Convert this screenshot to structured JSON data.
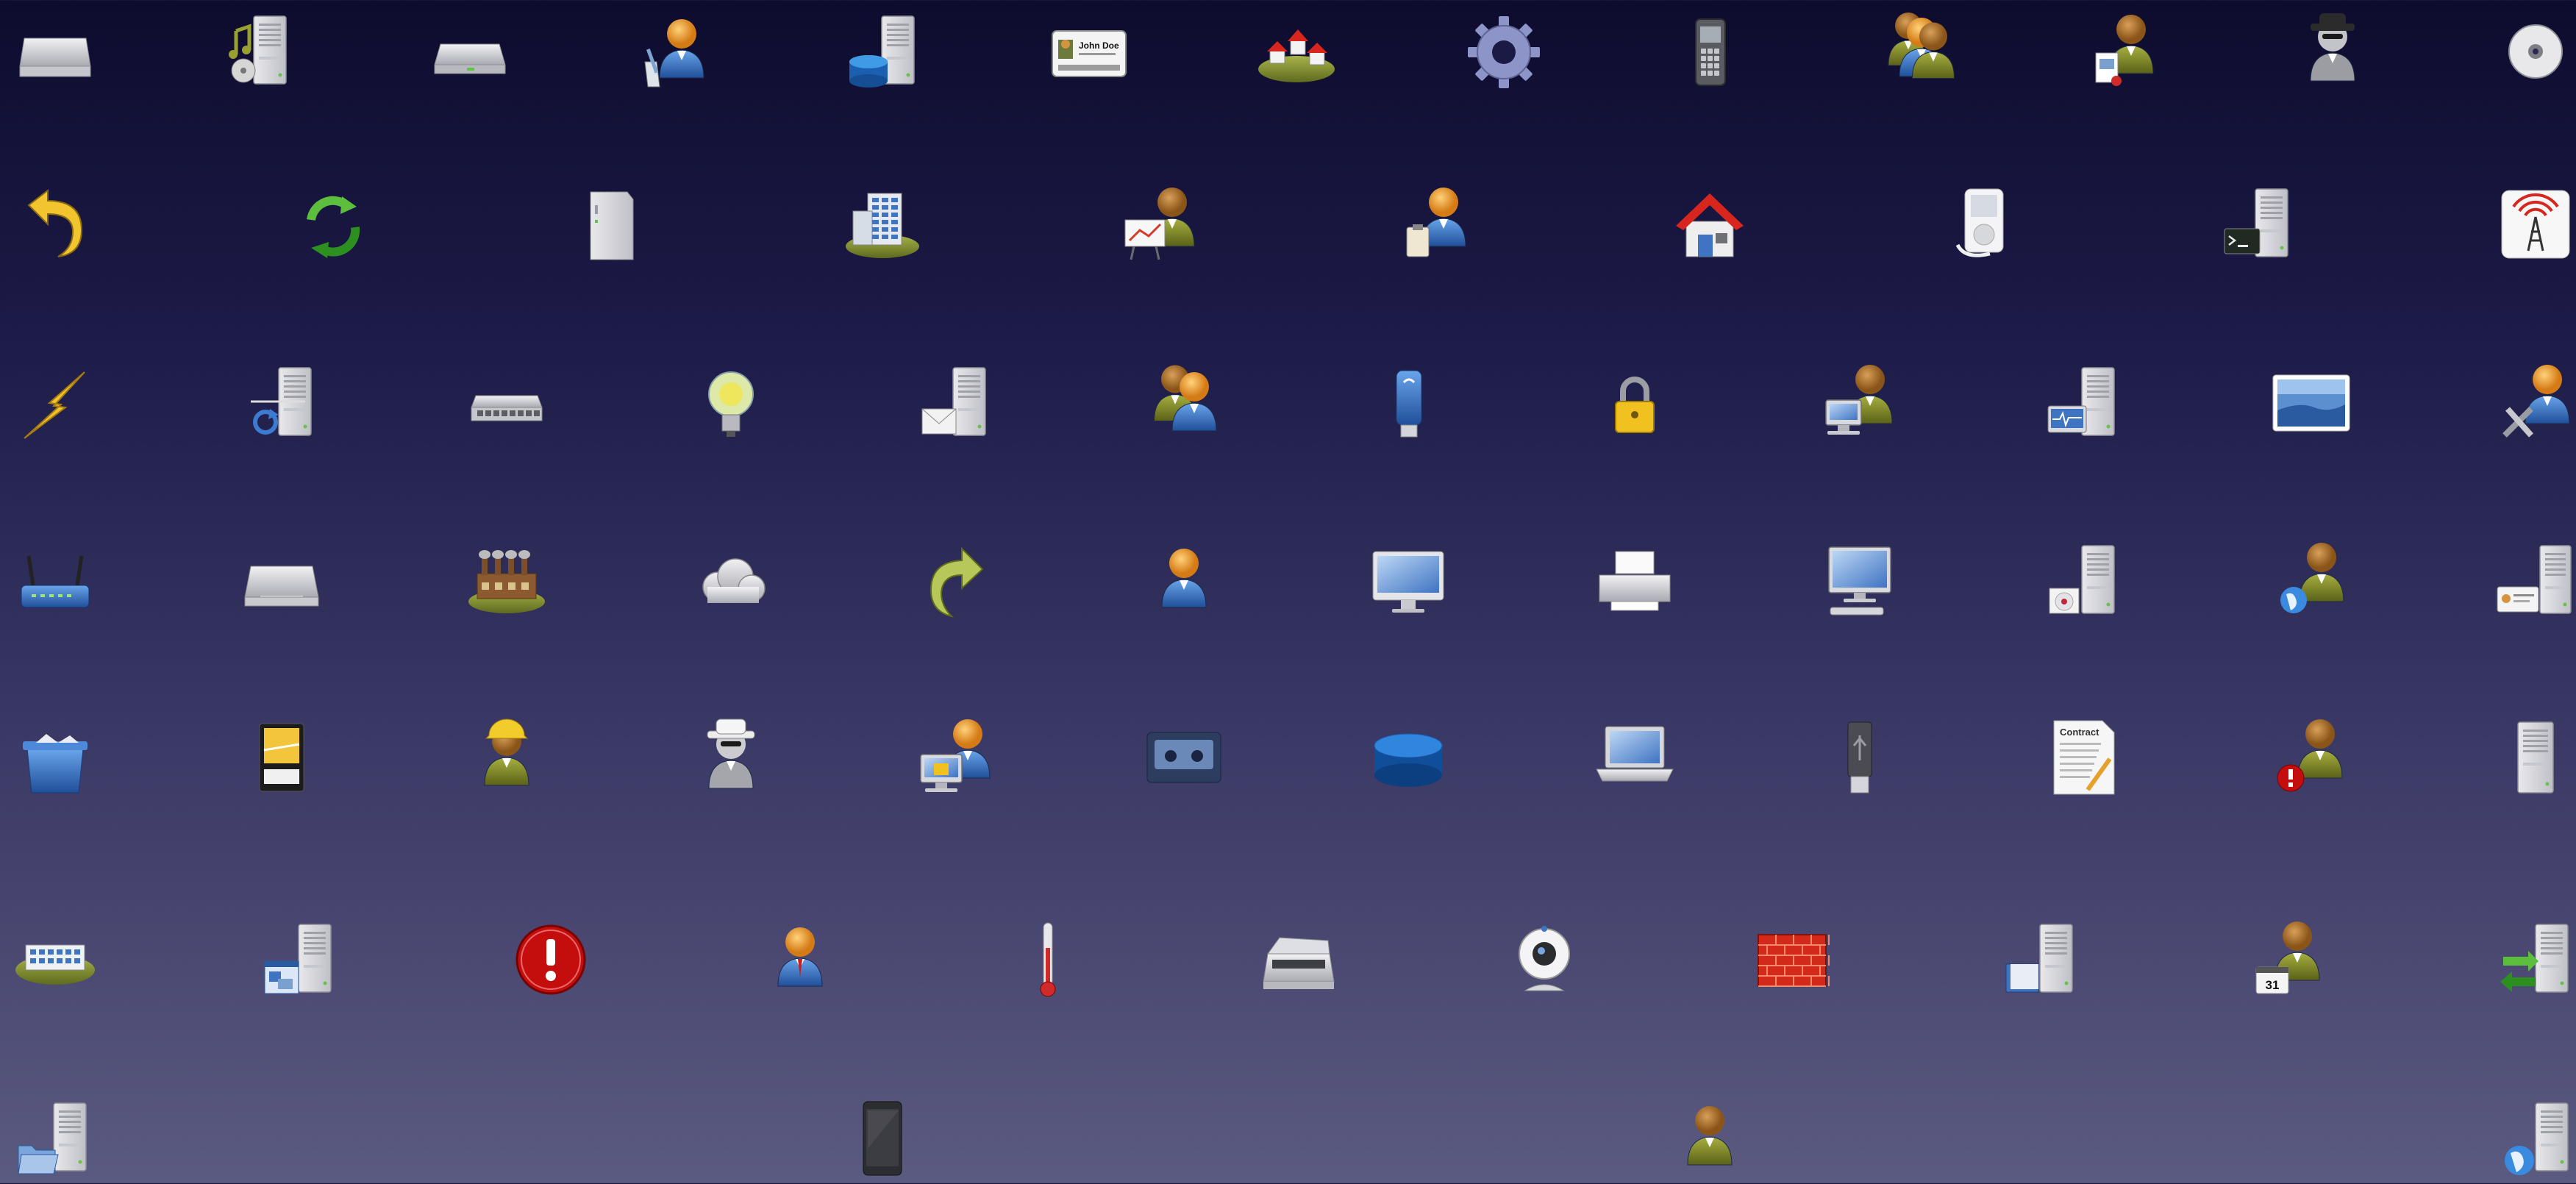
{
  "canvas": {
    "background_top": "#0d0c2e",
    "background_bottom": "#5b5a80"
  },
  "icons": [
    {
      "name": "harddisk-icon",
      "row": 0,
      "col": 0
    },
    {
      "name": "media-server-icon",
      "row": 0,
      "col": 1
    },
    {
      "name": "nas-drive-icon",
      "row": 0,
      "col": 2
    },
    {
      "name": "user-edit-icon",
      "row": 0,
      "col": 3
    },
    {
      "name": "database-server-icon",
      "row": 0,
      "col": 4
    },
    {
      "name": "id-card-icon",
      "row": 0,
      "col": 5,
      "text": "John Doe"
    },
    {
      "name": "village-icon",
      "row": 0,
      "col": 6
    },
    {
      "name": "gear-icon",
      "row": 0,
      "col": 7
    },
    {
      "name": "mobile-phone-icon",
      "row": 0,
      "col": 8
    },
    {
      "name": "user-group-icon",
      "row": 0,
      "col": 9
    },
    {
      "name": "user-report-icon",
      "row": 0,
      "col": 10
    },
    {
      "name": "spy-icon",
      "row": 0,
      "col": 11
    },
    {
      "name": "optical-disc-icon",
      "row": 0,
      "col": 12
    },
    {
      "name": "undo-arrow-icon",
      "row": 1,
      "col": 0
    },
    {
      "name": "refresh-cycle-icon",
      "row": 1,
      "col": 1
    },
    {
      "name": "tower-case-icon",
      "row": 1,
      "col": 2
    },
    {
      "name": "office-building-icon",
      "row": 1,
      "col": 3
    },
    {
      "name": "user-presentation-icon",
      "row": 1,
      "col": 4
    },
    {
      "name": "user-clipboard-icon",
      "row": 1,
      "col": 5
    },
    {
      "name": "home-icon",
      "row": 1,
      "col": 6
    },
    {
      "name": "media-player-icon",
      "row": 1,
      "col": 7
    },
    {
      "name": "terminal-server-icon",
      "row": 1,
      "col": 8
    },
    {
      "name": "radio-tower-icon",
      "row": 1,
      "col": 9
    },
    {
      "name": "lightning-icon",
      "row": 2,
      "col": 0
    },
    {
      "name": "server-sync-icon",
      "row": 2,
      "col": 1
    },
    {
      "name": "network-switch-icon",
      "row": 2,
      "col": 2
    },
    {
      "name": "light-bulb-icon",
      "row": 2,
      "col": 3
    },
    {
      "name": "mail-server-icon",
      "row": 2,
      "col": 4
    },
    {
      "name": "user-pair-icon",
      "row": 2,
      "col": 5
    },
    {
      "name": "usb-stick-blue-icon",
      "row": 2,
      "col": 6
    },
    {
      "name": "padlock-icon",
      "row": 2,
      "col": 7
    },
    {
      "name": "user-workstation-icon",
      "row": 2,
      "col": 8
    },
    {
      "name": "server-monitor-icon",
      "row": 2,
      "col": 9
    },
    {
      "name": "landscape-image-icon",
      "row": 2,
      "col": 10
    },
    {
      "name": "user-admin-tools-icon",
      "row": 2,
      "col": 11
    },
    {
      "name": "wireless-router-icon",
      "row": 3,
      "col": 0
    },
    {
      "name": "optical-drive-icon",
      "row": 3,
      "col": 1
    },
    {
      "name": "factory-icon",
      "row": 3,
      "col": 2
    },
    {
      "name": "cloud-icon",
      "row": 3,
      "col": 3
    },
    {
      "name": "redo-arrow-icon",
      "row": 3,
      "col": 4
    },
    {
      "name": "user-icon",
      "row": 3,
      "col": 5
    },
    {
      "name": "imac-icon",
      "row": 3,
      "col": 6
    },
    {
      "name": "printer-icon",
      "row": 3,
      "col": 7
    },
    {
      "name": "desktop-computer-icon",
      "row": 3,
      "col": 8
    },
    {
      "name": "cd-server-icon",
      "row": 3,
      "col": 9
    },
    {
      "name": "user-globe-icon",
      "row": 3,
      "col": 10
    },
    {
      "name": "id-card-server-icon",
      "row": 3,
      "col": 11
    },
    {
      "name": "trash-bin-icon",
      "row": 4,
      "col": 0
    },
    {
      "name": "memory-card-icon",
      "row": 4,
      "col": 1
    },
    {
      "name": "worker-hardhat-icon",
      "row": 4,
      "col": 2
    },
    {
      "name": "spy-agent-icon",
      "row": 4,
      "col": 3
    },
    {
      "name": "user-locked-computer-icon",
      "row": 4,
      "col": 4
    },
    {
      "name": "cassette-tape-icon",
      "row": 4,
      "col": 5
    },
    {
      "name": "database-icon",
      "row": 4,
      "col": 6
    },
    {
      "name": "laptop-icon",
      "row": 4,
      "col": 7
    },
    {
      "name": "usb-drive-icon",
      "row": 4,
      "col": 8
    },
    {
      "name": "contract-document-icon",
      "row": 4,
      "col": 9,
      "text": "Contract"
    },
    {
      "name": "user-warning-icon",
      "row": 4,
      "col": 10
    },
    {
      "name": "server-icon",
      "row": 4,
      "col": 11
    },
    {
      "name": "building-block-icon",
      "row": 5,
      "col": 0
    },
    {
      "name": "server-window-icon",
      "row": 5,
      "col": 1
    },
    {
      "name": "error-icon",
      "row": 5,
      "col": 2
    },
    {
      "name": "business-user-icon",
      "row": 5,
      "col": 3
    },
    {
      "name": "thermometer-icon",
      "row": 5,
      "col": 4
    },
    {
      "name": "scanner-icon",
      "row": 5,
      "col": 5
    },
    {
      "name": "webcam-icon",
      "row": 5,
      "col": 6
    },
    {
      "name": "firewall-icon",
      "row": 5,
      "col": 7
    },
    {
      "name": "book-server-icon",
      "row": 5,
      "col": 8
    },
    {
      "name": "user-calendar-icon",
      "row": 5,
      "col": 9,
      "text": "31"
    },
    {
      "name": "server-exchange-icon",
      "row": 5,
      "col": 10
    },
    {
      "name": "folder-server-icon",
      "row": 6,
      "col": 0
    },
    {
      "name": "smartphone-icon",
      "row": 6,
      "col": 1
    },
    {
      "name": "user-standalone-icon",
      "row": 6,
      "col": 2
    },
    {
      "name": "web-server-icon",
      "row": 6,
      "col": 3
    }
  ]
}
